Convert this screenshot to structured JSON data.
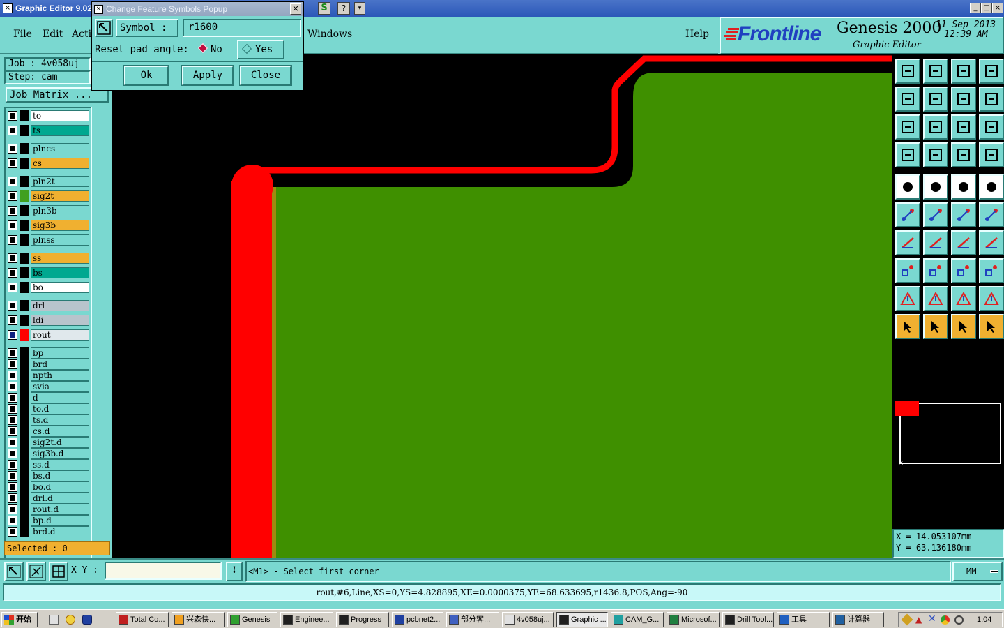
{
  "titlebar": {
    "title": "Graphic Editor 9.02",
    "buttons": [
      "_",
      "□",
      "×"
    ]
  },
  "menubar": {
    "items": [
      "File",
      "Edit",
      "Acti",
      "Windows",
      "Help"
    ]
  },
  "logo": {
    "brand": "Frontline",
    "product": "Genesis 2000",
    "subtitle": "Graphic Editor",
    "date": "11 Sep 2013",
    "time": "12:39 AM"
  },
  "job": {
    "job_label": "Job : 4v058uj",
    "step_label": "Step: cam",
    "matrix_button": "Job Matrix ..."
  },
  "layers": [
    {
      "name": "to",
      "color": "#ffffff",
      "swatch": "#000000"
    },
    {
      "name": "ts",
      "color": "#00a890",
      "swatch": "#000000"
    },
    {
      "name": "plncs",
      "color": "#7ad8d0",
      "swatch": "#000000"
    },
    {
      "name": "cs",
      "color": "#f0b030",
      "swatch": "#000000"
    },
    {
      "name": "pln2t",
      "color": "#7ad8d0",
      "swatch": "#000000"
    },
    {
      "name": "sig2t",
      "color": "#f0b030",
      "swatch": "#40a020"
    },
    {
      "name": "pln3b",
      "color": "#7ad8d0",
      "swatch": "#000000"
    },
    {
      "name": "sig3b",
      "color": "#f0b030",
      "swatch": "#000000"
    },
    {
      "name": "plnss",
      "color": "#7ad8d0",
      "swatch": "#000000"
    },
    {
      "name": "ss",
      "color": "#f0b030",
      "swatch": "#000000"
    },
    {
      "name": "bs",
      "color": "#00a890",
      "swatch": "#000000"
    },
    {
      "name": "bo",
      "color": "#ffffff",
      "swatch": "#000000"
    },
    {
      "name": "drl",
      "color": "#b8c4cc",
      "swatch": "#000000"
    },
    {
      "name": "ldi",
      "color": "#b8c4cc",
      "swatch": "#000000"
    },
    {
      "name": "rout",
      "color": "#e0e8ec",
      "swatch": "#ff0000",
      "active": true
    },
    {
      "name": "bp",
      "color": "#7ad8d0",
      "swatch": "#000000"
    },
    {
      "name": "brd",
      "color": "#7ad8d0",
      "swatch": "#000000"
    },
    {
      "name": "npth",
      "color": "#7ad8d0",
      "swatch": "#000000"
    },
    {
      "name": "svia",
      "color": "#7ad8d0",
      "swatch": "#000000"
    },
    {
      "name": "d",
      "color": "#7ad8d0",
      "swatch": "#000000"
    },
    {
      "name": "to.d",
      "color": "#7ad8d0",
      "swatch": "#000000"
    },
    {
      "name": "ts.d",
      "color": "#7ad8d0",
      "swatch": "#000000"
    },
    {
      "name": "cs.d",
      "color": "#7ad8d0",
      "swatch": "#000000"
    },
    {
      "name": "sig2t.d",
      "color": "#7ad8d0",
      "swatch": "#000000"
    },
    {
      "name": "sig3b.d",
      "color": "#7ad8d0",
      "swatch": "#000000"
    },
    {
      "name": "ss.d",
      "color": "#7ad8d0",
      "swatch": "#000000"
    },
    {
      "name": "bs.d",
      "color": "#7ad8d0",
      "swatch": "#000000"
    },
    {
      "name": "bo.d",
      "color": "#7ad8d0",
      "swatch": "#000000"
    },
    {
      "name": "drl.d",
      "color": "#7ad8d0",
      "swatch": "#000000"
    },
    {
      "name": "rout.d",
      "color": "#7ad8d0",
      "swatch": "#000000"
    },
    {
      "name": "bp.d",
      "color": "#7ad8d0",
      "swatch": "#000000"
    },
    {
      "name": "brd.d",
      "color": "#7ad8d0",
      "swatch": "#000000"
    }
  ],
  "selected": "Selected : 0",
  "popup": {
    "title": "Change Feature Symbols Popup",
    "symbol_label": "Symbol :",
    "symbol_value": "r1600",
    "reset_label": "Reset pad angle:",
    "option_no": "No",
    "option_yes": "Yes",
    "selected_option": "No",
    "ok": "Ok",
    "apply": "Apply",
    "close": "Close"
  },
  "coords": {
    "x": "X = 14.053107mm",
    "y": "Y = 63.136180mm"
  },
  "command": {
    "xy_label": "X Y :",
    "xy_value": "",
    "prompt": "<M1> - Select first corner",
    "units": "MM"
  },
  "status_line": "rout,#6,Line,XS=0,YS=4.828895,XE=0.0000375,YE=68.633695,r1436.8,POS,Ang=-90",
  "colors": {
    "ui_bg": "#7ad8d0",
    "board_fill": "#3f9000",
    "rout_line": "#ff0000",
    "canvas_bg": "#000000"
  },
  "taskbar": {
    "start": "开始",
    "tasks": [
      "Total Co...",
      "兴森快...",
      "Genesis",
      "Enginee...",
      "Progress",
      "pcbnet2...",
      "部分客...",
      "4v058uj...",
      "Graphic ...",
      "CAM_G...",
      "Microsof...",
      "Drill Tool...",
      "工具",
      "计算器"
    ],
    "active_task": "Graphic ...",
    "clock": "1:04"
  }
}
